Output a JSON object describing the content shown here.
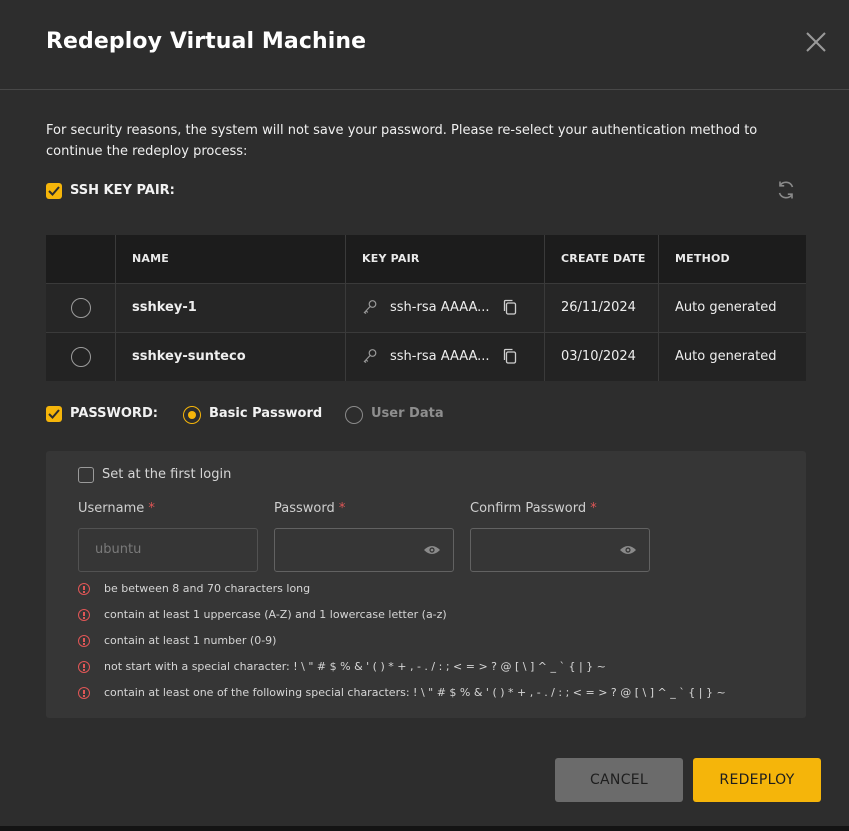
{
  "dialog": {
    "title": "Redeploy Virtual Machine",
    "intro": "For security reasons, the system will not save your password. Please re-select your authentication method to continue the redeploy process:"
  },
  "ssh": {
    "label": "SSH KEY PAIR:",
    "checked": true,
    "columns": [
      "NAME",
      "KEY PAIR",
      "CREATE DATE",
      "METHOD"
    ],
    "rows": [
      {
        "name": "sshkey-1",
        "key_pair": "ssh-rsa AAAA...",
        "create_date": "26/11/2024",
        "method": "Auto generated"
      },
      {
        "name": "sshkey-sunteco",
        "key_pair": "ssh-rsa AAAA...",
        "create_date": "03/10/2024",
        "method": "Auto generated"
      }
    ]
  },
  "password": {
    "label": "PASSWORD:",
    "checked": true,
    "options": [
      "Basic Password",
      "User Data"
    ],
    "selected_option": "Basic Password",
    "first_login_label": "Set at the first login",
    "first_login_checked": false,
    "username_label": "Username",
    "username_placeholder": "ubuntu",
    "password_label": "Password",
    "confirm_label": "Confirm Password",
    "required_mark": "*",
    "rules": [
      "be between 8 and 70 characters long",
      "contain at least 1 uppercase (A-Z) and 1 lowercase letter (a-z)",
      "contain at least 1 number (0-9)",
      "not start with a special character: ! \\ \" # $ % & ' ( ) * + , - . / : ; < = > ? @ [ \\ ] ^ _ ` { | } ~",
      "contain at least one of the following special characters: ! \\ \" # $ % & ' ( ) * + , - . / : ; < = > ? @ [ \\ ] ^ _ ` { | } ~"
    ]
  },
  "actions": {
    "cancel": "CANCEL",
    "redeploy": "REDEPLOY"
  },
  "colors": {
    "accent": "#f5b50a",
    "error": "#e05656",
    "background": "#2d2d2d"
  },
  "icons": {
    "close": "close-icon",
    "refresh": "refresh-icon",
    "key": "key-icon",
    "copy": "copy-icon",
    "eye": "eye-icon",
    "error": "error-circle-icon"
  }
}
